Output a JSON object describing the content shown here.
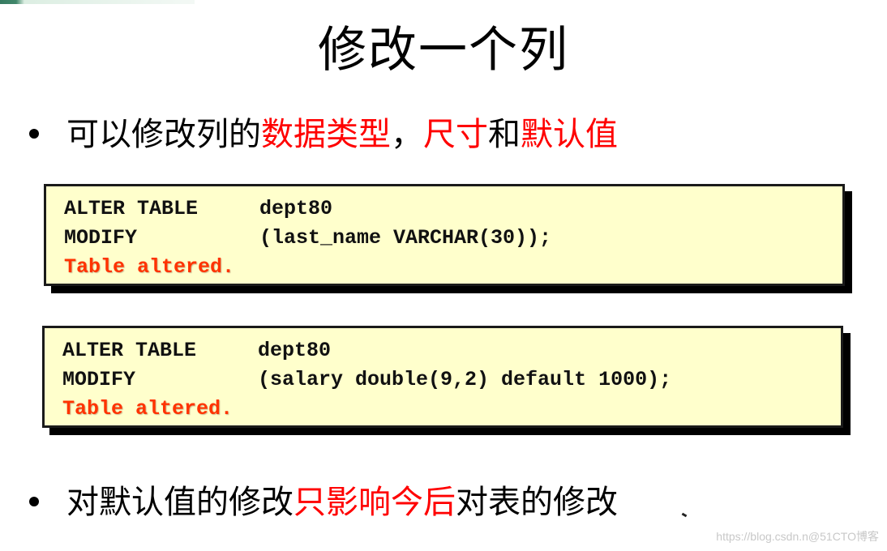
{
  "slide": {
    "title": "修改一个列",
    "bullets": [
      {
        "segments": [
          {
            "text": "可以修改列的",
            "color": "#000000"
          },
          {
            "text": "数据类型",
            "color": "#ff0000"
          },
          {
            "text": "，",
            "color": "#000000"
          },
          {
            "text": "尺寸",
            "color": "#ff0000"
          },
          {
            "text": "和",
            "color": "#000000"
          },
          {
            "text": "默认值",
            "color": "#ff0000"
          }
        ]
      },
      {
        "segments": [
          {
            "text": "对默认值的修改",
            "color": "#000000"
          },
          {
            "text": "只影响今后",
            "color": "#ff0000"
          },
          {
            "text": "对表的修改",
            "color": "#000000"
          }
        ]
      }
    ],
    "code_blocks": [
      {
        "lines": [
          {
            "keyword": "ALTER TABLE",
            "rest": "dept80"
          },
          {
            "keyword": "MODIFY",
            "rest": "(last_name VARCHAR(30));"
          }
        ],
        "result": "Table altered."
      },
      {
        "lines": [
          {
            "keyword": "ALTER TABLE",
            "rest": "dept80"
          },
          {
            "keyword": "MODIFY",
            "rest": "(salary double(9,2) default 1000);"
          }
        ],
        "result": "Table altered."
      }
    ],
    "watermark": "https://blog.csdn.n@51CTO博客"
  },
  "colors": {
    "highlight": "#ff0000",
    "code_background": "#ffffcc",
    "result_text": "#ff3300"
  }
}
